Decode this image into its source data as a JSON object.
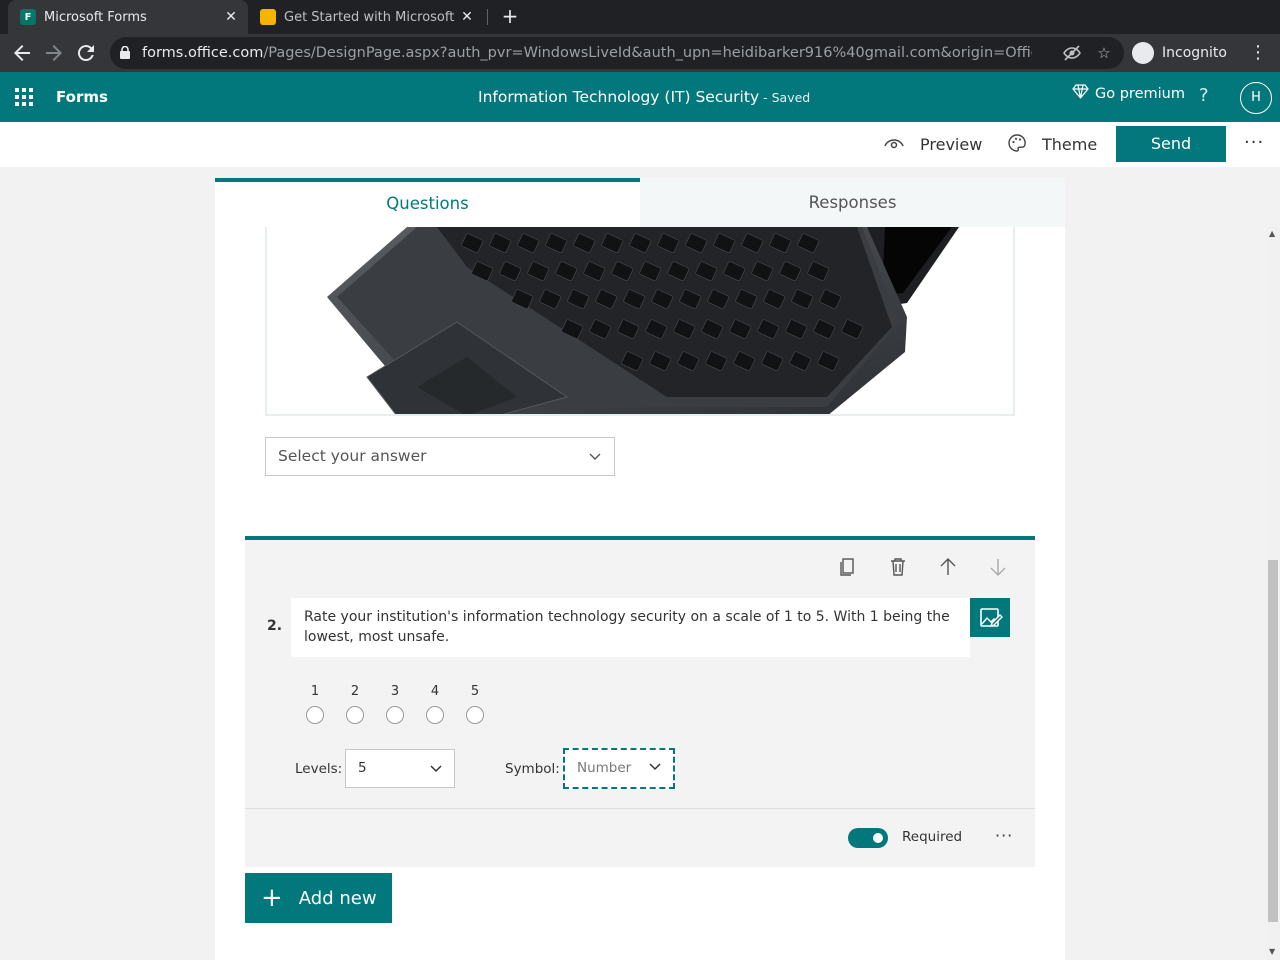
{
  "browser": {
    "tabs": [
      {
        "title": "Microsoft Forms",
        "active": true
      },
      {
        "title": "Get Started with Microsoft",
        "active": false
      }
    ],
    "url_host": "forms.office.com",
    "url_path": "/Pages/DesignPage.aspx?auth_pvr=WindowsLiveId&auth_upn=heidibarker916%40gmail.com&origin=Office...",
    "incognito_label": "Incognito"
  },
  "app": {
    "name": "Forms",
    "form_title": "Information Technology (IT) Security",
    "save_status": "- Saved",
    "premium_label": "Go premium",
    "help_label": "?",
    "avatar_initial": "H"
  },
  "commands": {
    "preview": "Preview",
    "theme": "Theme",
    "send": "Send",
    "more": "···"
  },
  "tabs": {
    "questions": "Questions",
    "responses": "Responses"
  },
  "question1": {
    "dropdown_placeholder": "Select your answer"
  },
  "question2": {
    "number": "2.",
    "text": "Rate your institution's information technology security on a scale of 1 to 5.  With 1 being the lowest, most unsafe.",
    "scale": [
      "1",
      "2",
      "3",
      "4",
      "5"
    ],
    "levels_label": "Levels:",
    "levels_value": "5",
    "symbol_label": "Symbol:",
    "symbol_value": "Number",
    "required_label": "Required",
    "required_on": true,
    "more": "···"
  },
  "add_new_label": "Add new",
  "colors": {
    "brand": "#03787c",
    "chrome_dark": "#202124"
  }
}
